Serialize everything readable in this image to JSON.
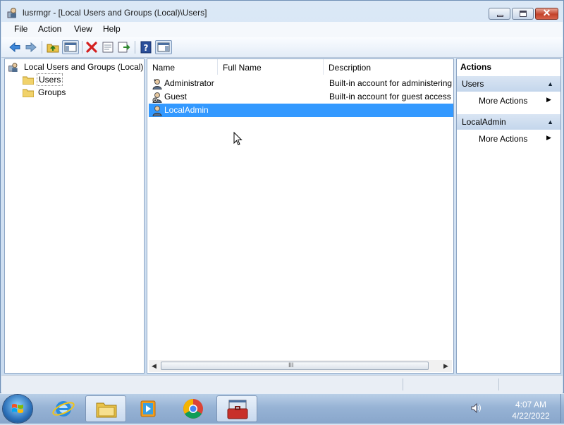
{
  "window": {
    "title": "lusrmgr - [Local Users and Groups (Local)\\Users]",
    "icon": "users-management-icon",
    "buttons": {
      "minimize": "minimize-icon",
      "maximize": "maximize-icon",
      "close": "close-icon",
      "close_glyph": "✕"
    }
  },
  "menu": [
    "File",
    "Action",
    "View",
    "Help"
  ],
  "toolbar": {
    "buttons": [
      "back-arrow-icon",
      "forward-arrow-icon",
      "up-folder-icon",
      "show-hide-console-tree-icon",
      "delete-icon",
      "properties-icon",
      "export-list-icon",
      "help-icon",
      "show-hide-action-pane-icon"
    ]
  },
  "tree": {
    "root": "Local Users and Groups (Local)",
    "children": [
      "Users",
      "Groups"
    ],
    "selected": "Users"
  },
  "list": {
    "columns": [
      "Name",
      "Full Name",
      "Description"
    ],
    "rows": [
      {
        "name": "Administrator",
        "full_name": "",
        "description": "Built-in account for administering the computer/domain"
      },
      {
        "name": "Guest",
        "full_name": "",
        "description": "Built-in account for guest access to the computer/domain"
      },
      {
        "name": "LocalAdmin",
        "full_name": "",
        "description": ""
      }
    ],
    "selected_row": "LocalAdmin",
    "scroll_grip": "III"
  },
  "actions": {
    "header": "Actions",
    "groups": [
      {
        "title": "Users",
        "items": [
          "More Actions"
        ]
      },
      {
        "title": "LocalAdmin",
        "items": [
          "More Actions"
        ]
      }
    ]
  },
  "taskbar": {
    "pinned": [
      "internet-explorer-icon",
      "file-explorer-icon",
      "media-player-icon",
      "chrome-icon",
      "computer-management-icon"
    ],
    "active": [
      "file-explorer-icon",
      "computer-management-icon"
    ],
    "time": "4:07 AM",
    "date": "4/22/2022"
  },
  "colors": {
    "selection": "#3399ff",
    "window_frame": "#dbe8f6",
    "actions_group": "#c4d6ec"
  }
}
